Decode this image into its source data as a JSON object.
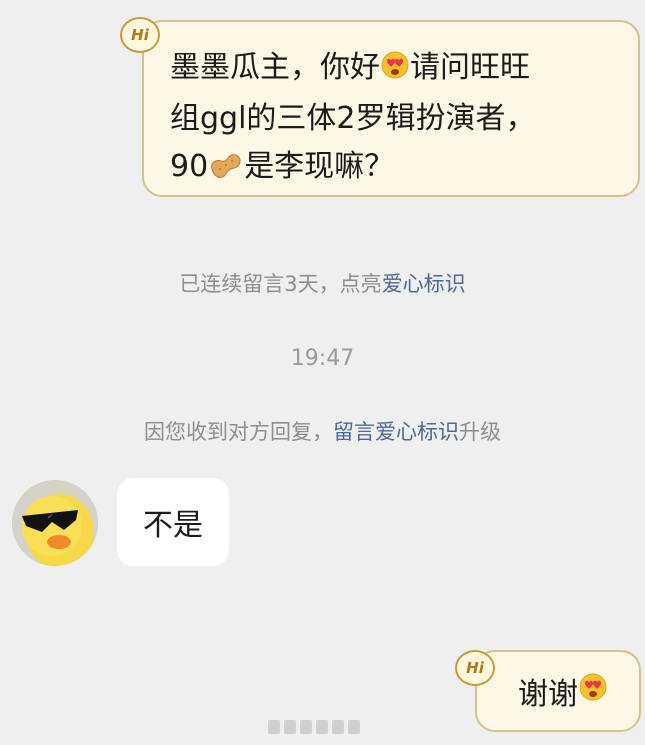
{
  "messages": {
    "first": {
      "hi_tag": "Hi",
      "line1_before": "墨墨瓜主，你好",
      "line1_after": "请问旺旺",
      "line2": "组ggl的三体2罗辑扮演者，",
      "line3_before": "90",
      "line3_after": "是李现嘛？",
      "emoji_face": "heart-eyes-face-icon",
      "emoji_peanut": "peanut-icon"
    },
    "reply": {
      "text": "不是"
    },
    "last": {
      "hi_tag": "Hi",
      "text": "谢谢",
      "emoji_face": "heart-eyes-face-icon"
    }
  },
  "system": {
    "streak_prefix": "已连续留言3天，点亮",
    "streak_link": "爱心标识",
    "time": "19:47",
    "upgrade_prefix": "因您收到对方回复，",
    "upgrade_link": "留言爱心标识",
    "upgrade_suffix": "升级"
  },
  "colors": {
    "page_bg": "#efefef",
    "my_bubble_bg": "#fdf7e6",
    "my_bubble_border": "#d9c08a",
    "link_accent": "#4c6a96",
    "system_text": "#8e8e8e"
  }
}
